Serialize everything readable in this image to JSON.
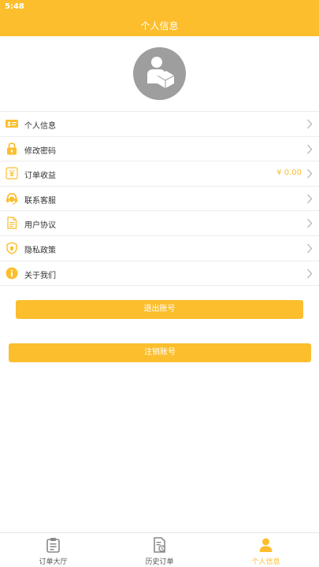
{
  "status_bar": {
    "time": "5:48"
  },
  "header": {
    "title": "个人信息"
  },
  "menu": [
    {
      "label": "个人信息",
      "icon": "id-card-icon"
    },
    {
      "label": "修改密码",
      "icon": "lock-icon"
    },
    {
      "label": "订单收益",
      "icon": "yen-icon",
      "value": "¥ 0.00"
    },
    {
      "label": "联系客服",
      "icon": "headset-icon"
    },
    {
      "label": "用户协议",
      "icon": "document-icon"
    },
    {
      "label": "隐私政策",
      "icon": "shield-icon"
    },
    {
      "label": "关于我们",
      "icon": "info-icon"
    }
  ],
  "buttons": {
    "logout": "退出账号",
    "cancel_account": "注销账号"
  },
  "tabbar": {
    "active_index": 2,
    "tabs": [
      {
        "label": "订单大厅",
        "icon": "clipboard-icon"
      },
      {
        "label": "历史订单",
        "icon": "history-doc-icon"
      },
      {
        "label": "个人信息",
        "icon": "person-icon"
      }
    ]
  },
  "colors": {
    "accent": "#FCBE2D",
    "avatar_bg": "#9E9E9E",
    "divider": "#ECECEC",
    "tab_inactive": "#888888"
  }
}
